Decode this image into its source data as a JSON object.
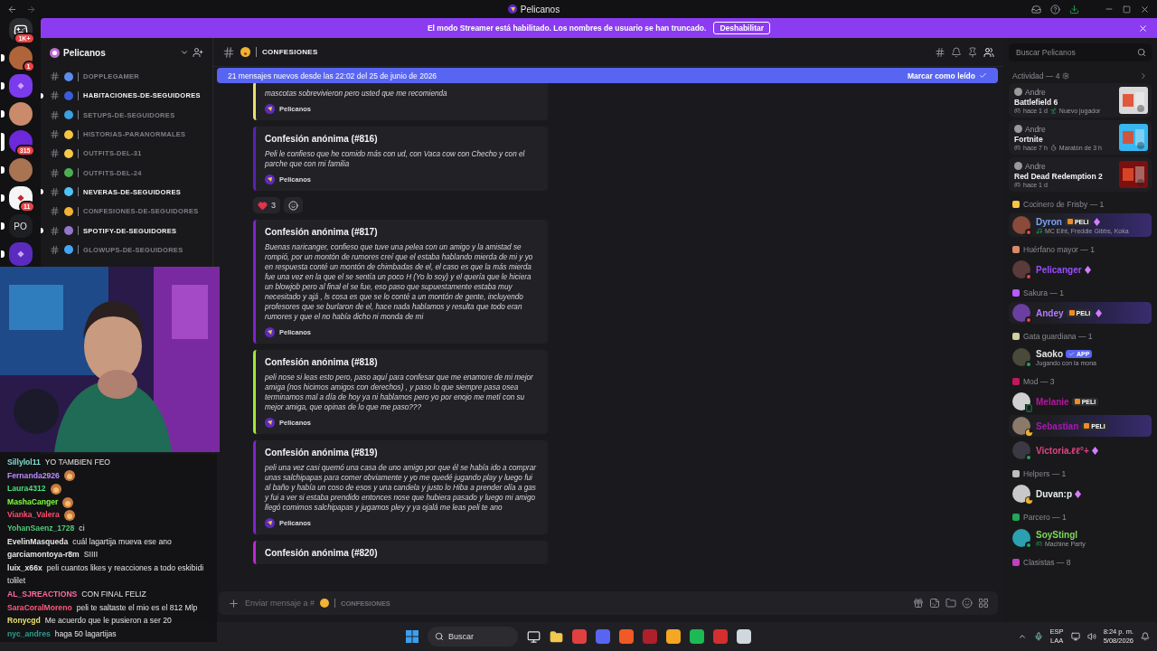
{
  "window": {
    "title": "Pelicanos"
  },
  "streamer_banner": {
    "text": "El modo Streamer está habilitado. Los nombres de usuario se han truncado.",
    "button": "Deshabilitar"
  },
  "servers": [
    {
      "kind": "home",
      "color": "#2b2d31",
      "badge": "1K+",
      "unread": false,
      "selected": false
    },
    {
      "kind": "avatar",
      "color": "#b0643a",
      "badge": "1",
      "unread": true,
      "selected": false
    },
    {
      "kind": "logo",
      "color": "#7c3aed",
      "unread": true,
      "selected": false
    },
    {
      "kind": "avatar",
      "color": "#c98b6b",
      "unread": true,
      "selected": false
    },
    {
      "kind": "avatar",
      "color": "#6d28d9",
      "badge": "315",
      "unread": false,
      "selected": true
    },
    {
      "kind": "avatar",
      "color": "#a97452",
      "unread": true,
      "selected": false
    },
    {
      "kind": "logo",
      "color": "#f5f5f5",
      "badge": "11",
      "unread": true,
      "selected": false
    },
    {
      "kind": "initials",
      "label": "PO",
      "color": "#1e1f22",
      "unread": true,
      "selected": false
    },
    {
      "kind": "logo",
      "color": "#5b2bbf",
      "unread": true,
      "selected": false
    }
  ],
  "server_name": "Pelicanos",
  "channels": [
    {
      "name": "DOPPLEGAMER",
      "color": "#5b8def",
      "unread": false
    },
    {
      "name": "HABITACIONES-DE-SEGUIDORES",
      "color": "#3b5bdb",
      "unread": true
    },
    {
      "name": "SETUPS-DE-SEGUIDORES",
      "color": "#3aa0e0",
      "unread": false
    },
    {
      "name": "HISTORIAS-PARANORMALES",
      "color": "#f5c542",
      "unread": false
    },
    {
      "name": "OUTFITS-DEL-31",
      "color": "#f7c948",
      "unread": false
    },
    {
      "name": "OUTFITS-DEL-24",
      "color": "#4caf50",
      "unread": false
    },
    {
      "name": "NEVERAS-DE-SEGUIDORES",
      "color": "#4fc3f7",
      "unread": true
    },
    {
      "name": "CONFESIONES-DE-SEGUIDORES",
      "color": "#f2b233",
      "unread": false
    },
    {
      "name": "SPOTIFY-DE-SEGUIDORES",
      "color": "#9575cd",
      "unread": true
    },
    {
      "name": "GLOWUPS-DE-SEGUIDORES",
      "color": "#42a5f5",
      "unread": false
    }
  ],
  "channel_header": {
    "name": "CONFESIONES"
  },
  "new_messages_bar": {
    "text": "21 mensajes nuevos desde las 22:02 del 25 de junio de 2026",
    "action": "Marcar como leído"
  },
  "messages": [
    {
      "kind": "embed",
      "color": "#e8e06a",
      "body": "mascotas sobrevivieron pero usted que me recomienda",
      "footer": "Pelicanos"
    },
    {
      "kind": "embed",
      "color": "#5b21b6",
      "title": "Confesión anónima (#816)",
      "body": "Peli le confieso que he comido más con ud, con Vaca cow con Checho y con el parche que con mi familia",
      "footer": "Pelicanos"
    },
    {
      "kind": "reactions",
      "count": "3"
    },
    {
      "kind": "embed",
      "color": "#7e22ce",
      "title": "Confesión anónima (#817)",
      "body": "Buenas naricanger, confieso que tuve una pelea con un amigo y la amistad se rompió, por un montón de rumores creí que el estaba hablando mierda de mi y yo en respuesta conté un montón de chimbadas de el, el caso es que la más mierda fue una vez en la que el se sentía un poco H (Yo lo soy) y el quería que le hiciera un blowjob pero al final el se fue, eso paso que supuestamente estaba muy necesitado y ajá , ls cosa es que se lo conté a un montón de gente, incluyendo profesores que se burlaron de el, hace nada hablamos y resulta que todo eran rumores y que el no había dicho ni monda de mi",
      "footer": "Pelicanos"
    },
    {
      "kind": "embed",
      "color": "#a3e635",
      "title": "Confesión anónima (#818)",
      "body": "peli nose si leas esto pero, paso aquí para confesar que me enamore de mi mejor amiga (nos hicimos amigos con derechos) , y paso lo que siempre pasa osea terminamos mal a día de hoy ya ni hablamos pero yo por enojo me metí con su mejor amiga, que opinas de lo que me paso???",
      "footer": "Pelicanos"
    },
    {
      "kind": "embed",
      "color": "#7e22ce",
      "title": "Confesión anónima (#819)",
      "body": "peli una vez casi quemó una casa de uno amigo por que él se había ido a comprar unas salchipapas para comer obviamente y yo me quedé jugando play y luego fui al baño y había un coso de esos y una candela y justo lo Hiba a prender olía a gas y fui a ver si estaba prendido entonces nose que hubiera pasado y luego mi amigo llegó comimos salchipapas y jugamos pley y ya ojalá me leas peli te ano",
      "footer": "Pelicanos"
    },
    {
      "kind": "embed",
      "color": "#c026d3",
      "title": "Confesión anónima (#820)"
    }
  ],
  "composer": {
    "prompt": "Enviar mensaje a #",
    "channel": "CONFESIONES"
  },
  "member_search": {
    "placeholder": "Buscar Pelicanos"
  },
  "activity": {
    "title": "Actividad — 4",
    "cards": [
      {
        "user": "Andre",
        "game": "Battlefield 6",
        "time": "hace 1 d",
        "extra": "Nuevo jugador"
      },
      {
        "user": "Andre",
        "game": "Fortnite",
        "time": "hace 7 h",
        "extra": "Maratón de 3 h"
      },
      {
        "user": "Andre",
        "game": "Red Dead Redemption 2",
        "time": "hace 1 d"
      }
    ]
  },
  "member_groups": [
    {
      "title": "Cocinero de Frisby — 1",
      "members": [
        {
          "name": "Dyron",
          "color": "#7aa2f7",
          "status": {
            "kind": "dnd"
          },
          "tag": {
            "kind": "guild",
            "text": "PELI"
          },
          "boost": true,
          "nameplate": true,
          "activity": "MC Eiht, Freddie Gibbs, Koka"
        }
      ]
    },
    {
      "title": "Huérfano mayor — 1",
      "members": [
        {
          "name": "Pelicanger",
          "color": "#9b4dff",
          "status": {
            "kind": "dnd"
          },
          "boost": true,
          "nameplate": false
        }
      ]
    },
    {
      "title": "Sakura — 1",
      "members": [
        {
          "name": "Andey",
          "color": "#b07cff",
          "status": {
            "kind": "dnd"
          },
          "tag": {
            "kind": "guild",
            "text": "PELI"
          },
          "boost": true,
          "nameplate": true
        }
      ]
    },
    {
      "title": "Gata guardiana — 1",
      "members": [
        {
          "name": "Saoko",
          "color": "#e6e6e6",
          "status": {
            "kind": "online"
          },
          "tag": {
            "kind": "bot",
            "text": "APP"
          },
          "boost": false,
          "nameplate": false,
          "activity": "Jugando con la mona"
        }
      ]
    },
    {
      "title": "Mod — 3",
      "members": [
        {
          "name": "Melanie",
          "color": "#b5179e",
          "status": {
            "kind": "mobile"
          },
          "tag": {
            "kind": "guild",
            "text": "PELI"
          },
          "boost": false,
          "nameplate": false
        },
        {
          "name": "Sebastian",
          "color": "#a21caf",
          "status": {
            "kind": "idle"
          },
          "tag": {
            "kind": "guild",
            "text": "PELI"
          },
          "boost": false,
          "nameplate": true
        },
        {
          "name": "Victoria.ℓℓ°+",
          "color": "#e0447f",
          "status": {
            "kind": "online"
          },
          "boost": true,
          "nameplate": false
        }
      ]
    },
    {
      "title": "Helpers — 1",
      "members": [
        {
          "name": "Duvan:p",
          "color": "#e6f0ea",
          "status": {
            "kind": "idle"
          },
          "boost": true,
          "nameplate": false
        }
      ]
    },
    {
      "title": "Parcero — 1",
      "members": [
        {
          "name": "SoyStingl",
          "color": "#7ed957",
          "status": {
            "kind": "online"
          },
          "boost": false,
          "nameplate": false,
          "activity": "Machine Party"
        }
      ]
    },
    {
      "title": "Clasistas — 8"
    }
  ],
  "stream_chat": [
    {
      "user": "Sillylol11",
      "color": "#7fe0d0",
      "text": "YO TAMBIEN FEO"
    },
    {
      "user": "Fernanda2926",
      "color": "#b98cff",
      "emote": true
    },
    {
      "user": "Laura4312",
      "color": "#4ade80",
      "emote": true
    },
    {
      "user": "MashaCanger",
      "color": "#7dff3a",
      "emote": true
    },
    {
      "user": "Vianka_Valera",
      "color": "#ff4d6d",
      "emote": true
    },
    {
      "user": "YohanSaenz_1728",
      "color": "#52c878",
      "text": "ci"
    },
    {
      "user": "EvelinMasqueda",
      "color": "#e6e6e6",
      "text": "cuál lagartija mueva ese ano"
    },
    {
      "user": "garciamontoya-r8m",
      "color": "#e6e6e6",
      "text": "SIIII"
    },
    {
      "user": "luix_x66x",
      "color": "#e6e6e6",
      "text": "peli cuantos likes y reacciones a todo eskibidi tolilet"
    },
    {
      "user": "AL_SJREACTIONS",
      "color": "#ff6b9d",
      "text": "CON FINAL FELIZ"
    },
    {
      "user": "SaraCoralMoreno",
      "color": "#ff5a7a",
      "text": "peli te saltaste el mio es el 812 Mlp"
    },
    {
      "user": "Ronycgd",
      "color": "#e8e070",
      "text": "Me acuerdo que le pusieron a ser 20"
    },
    {
      "user": "nyc_andres",
      "color": "#2a9d8f",
      "text": "haga 50 lagartijas"
    }
  ],
  "taskbar": {
    "search": "Buscar",
    "lang": "ESP",
    "layout": "LAA",
    "time": "8:24 p. m.",
    "date": "5/08/2026"
  }
}
